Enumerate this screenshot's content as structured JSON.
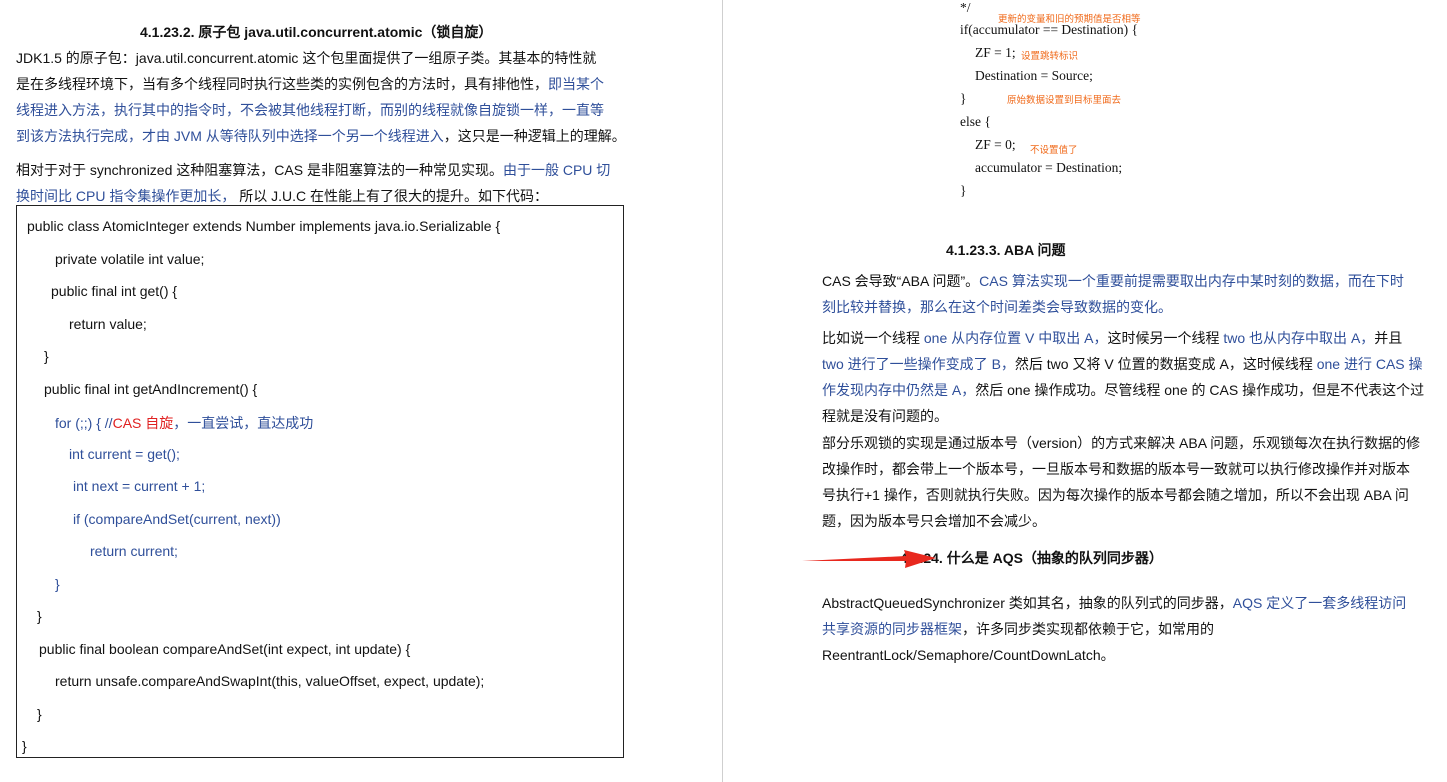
{
  "left": {
    "heading": "4.1.23.2.   原子包 java.util.concurrent.atomic（锁自旋）",
    "para1": {
      "l1": "JDK1.5 的原子包：java.util.concurrent.atomic 这个包里面提供了一组原子类。其基本的特性就",
      "l2a": "是在多线程环境下，当有多个线程同时执行这些类的实例包含的方法时，具有排他性，",
      "l2b": "即当某个",
      "l3": "线程进入方法，执行其中的指令时，不会被其他线程打断，而别的线程就像自旋锁一样，一直等",
      "l4a": "到该方法执行完成，才由 JVM 从等待队列中选择一个另一个线程进入",
      "l4b": "，这只是一种逻辑上的理解。"
    },
    "para2": {
      "l1a": "相对于对于 synchronized 这种阻塞算法，CAS 是非阻塞算法的一种常见实现。",
      "l1b": "由于一般 CPU 切",
      "l2a": "换时间比 CPU 指令集操作更加长，",
      "l2b": " 所以 J.U.C 在性能上有了很大的提升。如下代码："
    },
    "code": {
      "c1": "public class AtomicInteger extends Number implements java.io.Serializable {",
      "c2": "private volatile int value;",
      "c3": "public final int get() {",
      "c4": "return value;",
      "c5": "}",
      "c6": "public final int getAndIncrement() {",
      "c7a": "for (;;) {  //",
      "c7b": "CAS 自旋",
      "c7c": "，一直尝试，直达成功",
      "c8": "int current = get();",
      "c9": "int next = current + 1;",
      "c10": "if (compareAndSet(current, next))",
      "c11": "return current;",
      "c12": "}",
      "c13": "}",
      "c14": "public final boolean compareAndSet(int expect, int update) {",
      "c15": "return unsafe.compareAndSwapInt(this, valueOffset, expect, update);",
      "c16": "}",
      "c17": "}"
    }
  },
  "right": {
    "code": {
      "r0": "*/",
      "r1": "if(accumulator == Destination) {",
      "r2": "ZF = 1;",
      "r3": "Destination = Source;",
      "r4": "}",
      "r5": "else {",
      "r6": "ZF = 0;",
      "r7": "accumulator = Destination;",
      "r8": "}"
    },
    "notes": {
      "n1": "更新的变量和旧的预期值是否相等",
      "n2": "设置跳转标识",
      "n3": "原始数据设置到目标里面去",
      "n4": "不设置值了"
    },
    "heading_aba": "4.1.23.3.   ABA 问题",
    "aba1": {
      "l1a": "CAS 会导致“ABA 问题”。",
      "l1b": "CAS 算法实现一个重要前提需要取出内存中某时刻的数据，而在下时",
      "l2": "刻比较并替换，那么在这个时间差类会导致数据的变化。"
    },
    "aba2": {
      "l1a": "比如说一个线程 ",
      "l1b": "one 从内存位置 V 中取出 A，",
      "l1c": "这时候另一个线程 ",
      "l1d": "two 也从内存中取出 A，",
      "l1e": "并且",
      "l2a": "two 进行了一些操作变成了 B，",
      "l2b": "然后 two 又将 V 位置的数据变成 A，这时候线程 ",
      "l2c": "one 进行 CAS 操",
      "l3a": "作发现内存中仍然是 A，",
      "l3b": "然后 one 操作成功。尽管线程 one 的 CAS 操作成功，但是不代表这个过",
      "l4": "程就是没有问题的。"
    },
    "aba3": {
      "l1": "部分乐观锁的实现是通过版本号（version）的方式来解决 ABA 问题，乐观锁每次在执行数据的修",
      "l2": "改操作时，都会带上一个版本号，一旦版本号和数据的版本号一致就可以执行修改操作并对版本",
      "l3": "号执行+1 操作，否则就执行失败。因为每次操作的版本号都会随之增加，所以不会出现 ABA 问",
      "l4": "题，因为版本号只会增加不会减少。"
    },
    "heading_aqs": "4.1.24.    什么是 AQS（抽象的队列同步器）",
    "aqs": {
      "l1a": "AbstractQueuedSynchronizer 类如其名，抽象的队列式的同步器，",
      "l1b": "AQS 定义了一套多线程访问",
      "l2a": "共享资源的同步器框架",
      "l2b": "，许多同步类实现都依赖于它，如常用的",
      "l3": "ReentrantLock/Semaphore/CountDownLatch。"
    },
    "arrow_color": "#e8281e"
  }
}
